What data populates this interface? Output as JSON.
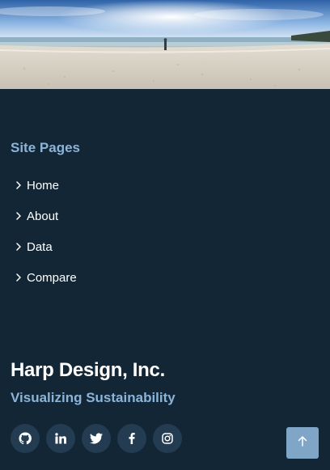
{
  "hero": {
    "icon": "beach-photo"
  },
  "site_pages": {
    "heading": "Site Pages",
    "items": [
      {
        "label": "Home"
      },
      {
        "label": "About"
      },
      {
        "label": "Data"
      },
      {
        "label": "Compare"
      }
    ]
  },
  "footer": {
    "company": "Harp Design, Inc.",
    "tagline": "Visualizing Sustainability"
  },
  "socials": [
    {
      "icon": "github-icon"
    },
    {
      "icon": "linkedin-icon"
    },
    {
      "icon": "twitter-icon"
    },
    {
      "icon": "facebook-icon"
    },
    {
      "icon": "instagram-icon"
    }
  ],
  "back_to_top": {
    "icon": "arrow-up-icon"
  },
  "colors": {
    "background": "#132636",
    "accent": "#8cb4d8",
    "social_bg": "#243c52",
    "back_to_top_bg": "#7fa6c6"
  }
}
